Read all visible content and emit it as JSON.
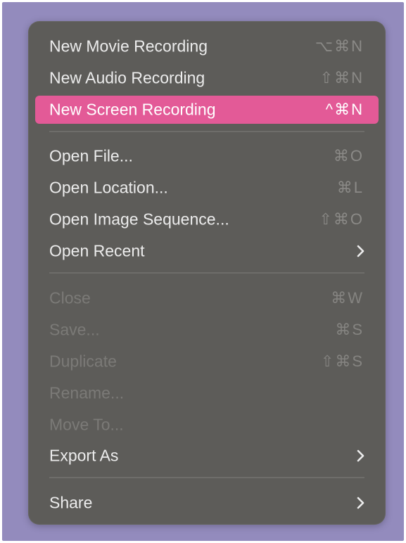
{
  "menu": {
    "items": [
      {
        "label": "New Movie Recording",
        "shortcut": "⌥⌘N"
      },
      {
        "label": "New Audio Recording",
        "shortcut": "⇧⌘N"
      },
      {
        "label": "New Screen Recording",
        "shortcut": "^⌘N"
      },
      {
        "label": "Open File...",
        "shortcut": "⌘O"
      },
      {
        "label": "Open Location...",
        "shortcut": "⌘L"
      },
      {
        "label": "Open Image Sequence...",
        "shortcut": "⇧⌘O"
      },
      {
        "label": "Open Recent",
        "icon": "chevron-right-icon"
      },
      {
        "label": "Close",
        "shortcut": "⌘W"
      },
      {
        "label": "Save...",
        "shortcut": "⌘S"
      },
      {
        "label": "Duplicate",
        "shortcut": "⇧⌘S"
      },
      {
        "label": "Rename..."
      },
      {
        "label": "Move To..."
      },
      {
        "label": "Export As",
        "icon": "chevron-right-icon"
      },
      {
        "label": "Share",
        "icon": "chevron-right-icon"
      }
    ],
    "highlighted_label": "New Screen Recording",
    "disabled_labels": [
      "Close",
      "Save...",
      "Duplicate",
      "Rename...",
      "Move To..."
    ]
  },
  "colors": {
    "background": "#938bbd",
    "menu_background": "#5d5c59",
    "highlight": "#e35a97",
    "text": "#ececec",
    "disabled_text": "#7b7a77"
  }
}
